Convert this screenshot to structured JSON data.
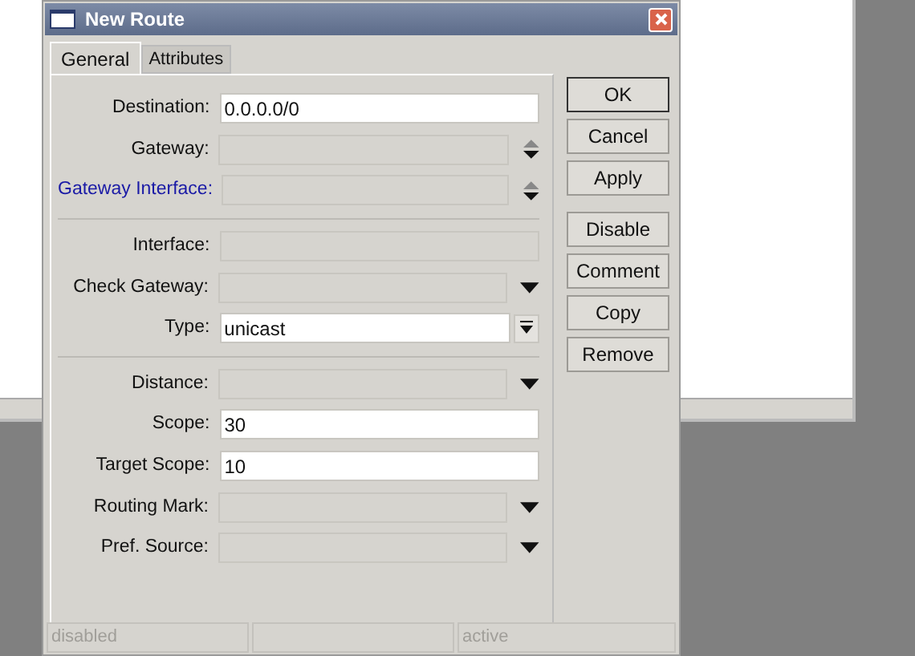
{
  "window": {
    "title": "New Route"
  },
  "tabs": [
    {
      "label": "General",
      "selected": true
    },
    {
      "label": "Attributes",
      "selected": false
    }
  ],
  "sections": [
    {
      "rows": [
        {
          "label": "Destination:",
          "kind": "text",
          "value": "0.0.0.0/0",
          "enabled": true,
          "focused": false
        },
        {
          "label": "Gateway:",
          "kind": "updown",
          "enabled": false,
          "focused": false
        },
        {
          "label": "Gateway Interface:",
          "kind": "updown",
          "enabled": false,
          "focused": true
        }
      ]
    },
    {
      "rows": [
        {
          "label": "Interface:",
          "kind": "text",
          "enabled": false,
          "focused": false
        },
        {
          "label": "Check Gateway:",
          "kind": "dropdown",
          "enabled": false,
          "focused": false
        },
        {
          "label": "Type:",
          "kind": "combo",
          "value": "unicast",
          "enabled": true,
          "focused": false
        }
      ]
    },
    {
      "rows": [
        {
          "label": "Distance:",
          "kind": "dropdown",
          "enabled": false,
          "focused": false
        },
        {
          "label": "Scope:",
          "kind": "text",
          "value": "30",
          "enabled": true,
          "focused": false
        },
        {
          "label": "Target Scope:",
          "kind": "text",
          "value": "10",
          "enabled": true,
          "focused": false
        },
        {
          "label": "Routing Mark:",
          "kind": "dropdown",
          "enabled": false,
          "focused": false
        },
        {
          "label": "Pref. Source:",
          "kind": "dropdown",
          "enabled": false,
          "focused": false
        }
      ]
    }
  ],
  "button_groups": [
    {
      "buttons": [
        {
          "label": "OK",
          "default": true
        },
        {
          "label": "Cancel",
          "default": false
        },
        {
          "label": "Apply",
          "default": false
        }
      ]
    },
    {
      "buttons": [
        {
          "label": "Disable",
          "default": false
        },
        {
          "label": "Comment",
          "default": false
        },
        {
          "label": "Copy",
          "default": false
        },
        {
          "label": "Remove",
          "default": false
        }
      ]
    }
  ],
  "status_bar": {
    "left": "disabled",
    "right": "active"
  }
}
